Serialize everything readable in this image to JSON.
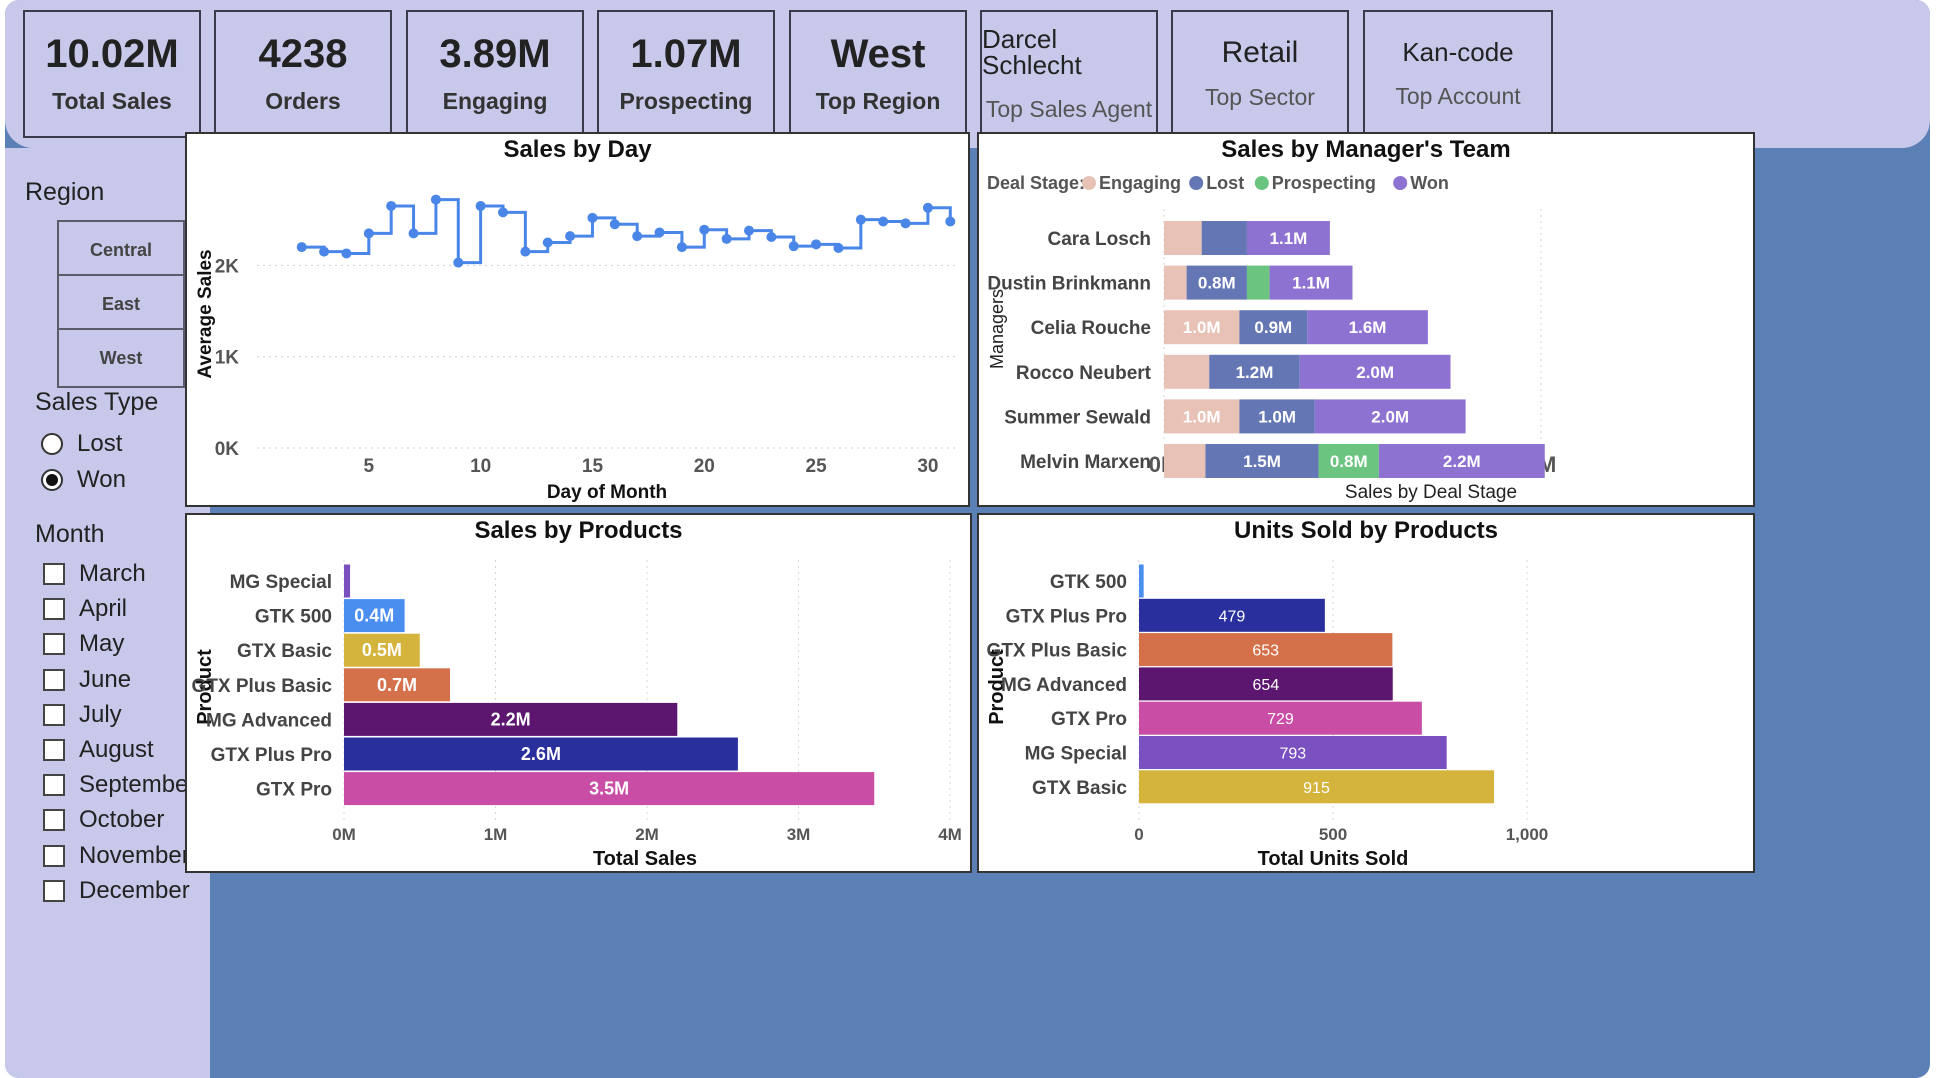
{
  "kpis": [
    {
      "value": "10.02M",
      "label": "Total Sales"
    },
    {
      "value": "4238",
      "label": "Orders"
    },
    {
      "value": "3.89M",
      "label": "Engaging"
    },
    {
      "value": "1.07M",
      "label": "Prospecting"
    },
    {
      "value": "West",
      "label": "Top Region"
    },
    {
      "value": "Darcel Schlecht",
      "label": "Top Sales Agent"
    },
    {
      "value": "Retail",
      "label": "Top Sector"
    },
    {
      "value": "Kan-code",
      "label": "Top Account"
    }
  ],
  "filters": {
    "region_title": "Region",
    "regions": [
      "Central",
      "East",
      "West"
    ],
    "sales_type_title": "Sales Type",
    "sales_types": [
      {
        "label": "Lost",
        "selected": false
      },
      {
        "label": "Won",
        "selected": true
      }
    ],
    "month_title": "Month",
    "months": [
      "March",
      "April",
      "May",
      "June",
      "July",
      "August",
      "September",
      "October",
      "November",
      "December"
    ]
  },
  "chart_data": [
    {
      "type": "line",
      "title": "Sales by Day",
      "xlabel": "Day of Month",
      "ylabel": "Average Sales",
      "x": [
        2,
        3,
        4,
        5,
        6,
        7,
        8,
        9,
        10,
        11,
        12,
        13,
        14,
        15,
        16,
        17,
        18,
        19,
        20,
        21,
        22,
        23,
        24,
        25,
        26,
        27,
        28,
        29,
        30,
        31
      ],
      "values": [
        2200,
        2150,
        2130,
        2350,
        2650,
        2350,
        2720,
        2030,
        2650,
        2580,
        2150,
        2250,
        2320,
        2520,
        2450,
        2320,
        2360,
        2200,
        2390,
        2290,
        2380,
        2310,
        2210,
        2230,
        2190,
        2500,
        2480,
        2460,
        2630,
        2480
      ],
      "x_ticks": [
        "5",
        "10",
        "15",
        "20",
        "25",
        "30"
      ],
      "y_ticks": [
        "0K",
        "1K",
        "2K"
      ],
      "ylim": [
        0,
        3000
      ],
      "color": "#4a86e8",
      "step": true
    },
    {
      "type": "bar",
      "stacked": true,
      "orientation": "horizontal",
      "title": "Sales by Manager's Team",
      "legend_title": "Deal Stage:",
      "xlabel": "Sales by Deal Stage",
      "ylabel": "Managers",
      "x_ticks": [
        "0M",
        "5M"
      ],
      "xlim": [
        0,
        5
      ],
      "categories": [
        "Cara Losch",
        "Dustin Brinkmann",
        "Celia Rouche",
        "Rocco Neubert",
        "Summer Sewald",
        "Melvin Marxen"
      ],
      "series": [
        {
          "name": "Engaging",
          "color": "#e9c2b7",
          "values": [
            0.5,
            0.3,
            1.0,
            0.6,
            1.0,
            0.55
          ],
          "labels": [
            "",
            "",
            "1.0M",
            "",
            "1.0M",
            ""
          ]
        },
        {
          "name": "Lost",
          "color": "#6576b5",
          "values": [
            0.6,
            0.8,
            0.9,
            1.2,
            1.0,
            1.5
          ],
          "labels": [
            "",
            "0.8M",
            "0.9M",
            "1.2M",
            "1.0M",
            "1.5M"
          ]
        },
        {
          "name": "Prospecting",
          "color": "#6bc480",
          "values": [
            0,
            0.3,
            0,
            0,
            0,
            0.8
          ],
          "labels": [
            "",
            "",
            "",
            "",
            "",
            "0.8M"
          ]
        },
        {
          "name": "Won",
          "color": "#8e72d1",
          "values": [
            1.1,
            1.1,
            1.6,
            2.0,
            2.0,
            2.2
          ],
          "labels": [
            "1.1M",
            "1.1M",
            "1.6M",
            "2.0M",
            "2.0M",
            "2.2M"
          ]
        }
      ]
    },
    {
      "type": "bar",
      "orientation": "horizontal",
      "title": "Sales by Products",
      "xlabel": "Total Sales",
      "ylabel": "Product",
      "x_ticks": [
        "0M",
        "1M",
        "2M",
        "3M",
        "4M"
      ],
      "xlim": [
        0,
        4
      ],
      "categories": [
        "MG Special",
        "GTK 500",
        "GTX Basic",
        "GTX Plus Basic",
        "MG Advanced",
        "GTX Plus Pro",
        "GTX Pro"
      ],
      "values": [
        0.04,
        0.4,
        0.5,
        0.7,
        2.2,
        2.6,
        3.5
      ],
      "labels": [
        "",
        "0.4M",
        "0.5M",
        "0.7M",
        "2.2M",
        "2.6M",
        "3.5M"
      ],
      "colors": [
        "#7a4fc0",
        "#4a8ef0",
        "#d4b43c",
        "#d4714a",
        "#5c1670",
        "#2a2f9e",
        "#c94da5"
      ]
    },
    {
      "type": "bar",
      "orientation": "horizontal",
      "title": "Units Sold by Products",
      "xlabel": "Total Units Sold",
      "ylabel": "Product",
      "x_ticks": [
        "0",
        "500",
        "1,000"
      ],
      "xlim": [
        0,
        1000
      ],
      "categories": [
        "GTK 500",
        "GTX Plus Pro",
        "GTX Plus Basic",
        "MG Advanced",
        "GTX Pro",
        "MG Special",
        "GTX Basic"
      ],
      "values": [
        12,
        479,
        653,
        654,
        729,
        793,
        915
      ],
      "labels": [
        "",
        "479",
        "653",
        "654",
        "729",
        "793",
        "915"
      ],
      "colors": [
        "#4a8ef0",
        "#2a2f9e",
        "#d4714a",
        "#5c1670",
        "#c94da5",
        "#7a4fc0",
        "#d4b43c"
      ]
    }
  ]
}
